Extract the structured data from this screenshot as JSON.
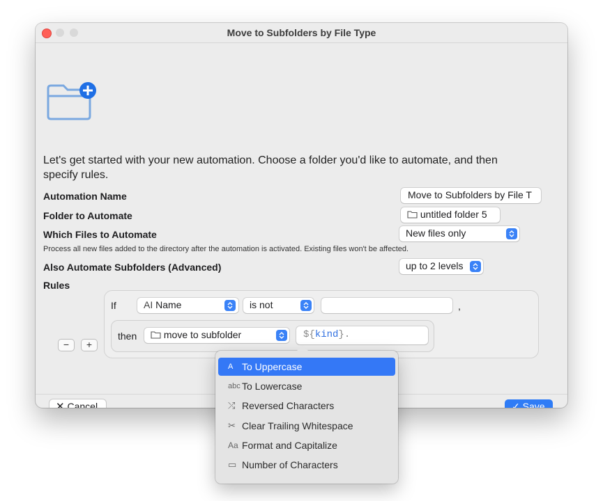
{
  "window": {
    "title": "Move to Subfolders by File Type"
  },
  "intro": "Let's get started with your new automation. Choose a folder you'd like to automate, and then specify rules.",
  "form": {
    "automation_name": {
      "label": "Automation Name",
      "value": "Move to Subfolders by File T"
    },
    "folder": {
      "label": "Folder to Automate",
      "value": "untitled folder 5"
    },
    "which_files": {
      "label": "Which Files to Automate",
      "value": "New files only",
      "note": "Process all new files added to the directory after the automation is activated. Existing files won't be affected."
    },
    "subfolders": {
      "label": "Also Automate Subfolders (Advanced)",
      "value": "up to 2 levels"
    },
    "rules_label": "Rules"
  },
  "rule": {
    "if_label": "If",
    "attribute_icon": "AI",
    "attribute": "Name",
    "operator": "is not",
    "value": "",
    "comma": ",",
    "then_label": "then",
    "action": "move to subfolder",
    "target_prefix": "${",
    "target_token": "kind",
    "target_suffix": "}."
  },
  "rule_controls": {
    "remove": "−",
    "add": "+"
  },
  "footer": {
    "cancel": "Cancel",
    "save": "Save"
  },
  "menu": {
    "items": [
      {
        "icon": "A",
        "label": "To Uppercase",
        "selected": true
      },
      {
        "icon": "abc",
        "label": "To Lowercase"
      },
      {
        "icon": "⤮",
        "label": "Reversed Characters"
      },
      {
        "icon": "✂",
        "label": "Clear Trailing Whitespace"
      },
      {
        "icon": "Aa",
        "label": "Format and Capitalize"
      },
      {
        "icon": "▭",
        "label": "Number of Characters"
      }
    ]
  },
  "colors": {
    "accent": "#3478f6",
    "token": "#2f6fe0",
    "close": "#ff5f57"
  }
}
